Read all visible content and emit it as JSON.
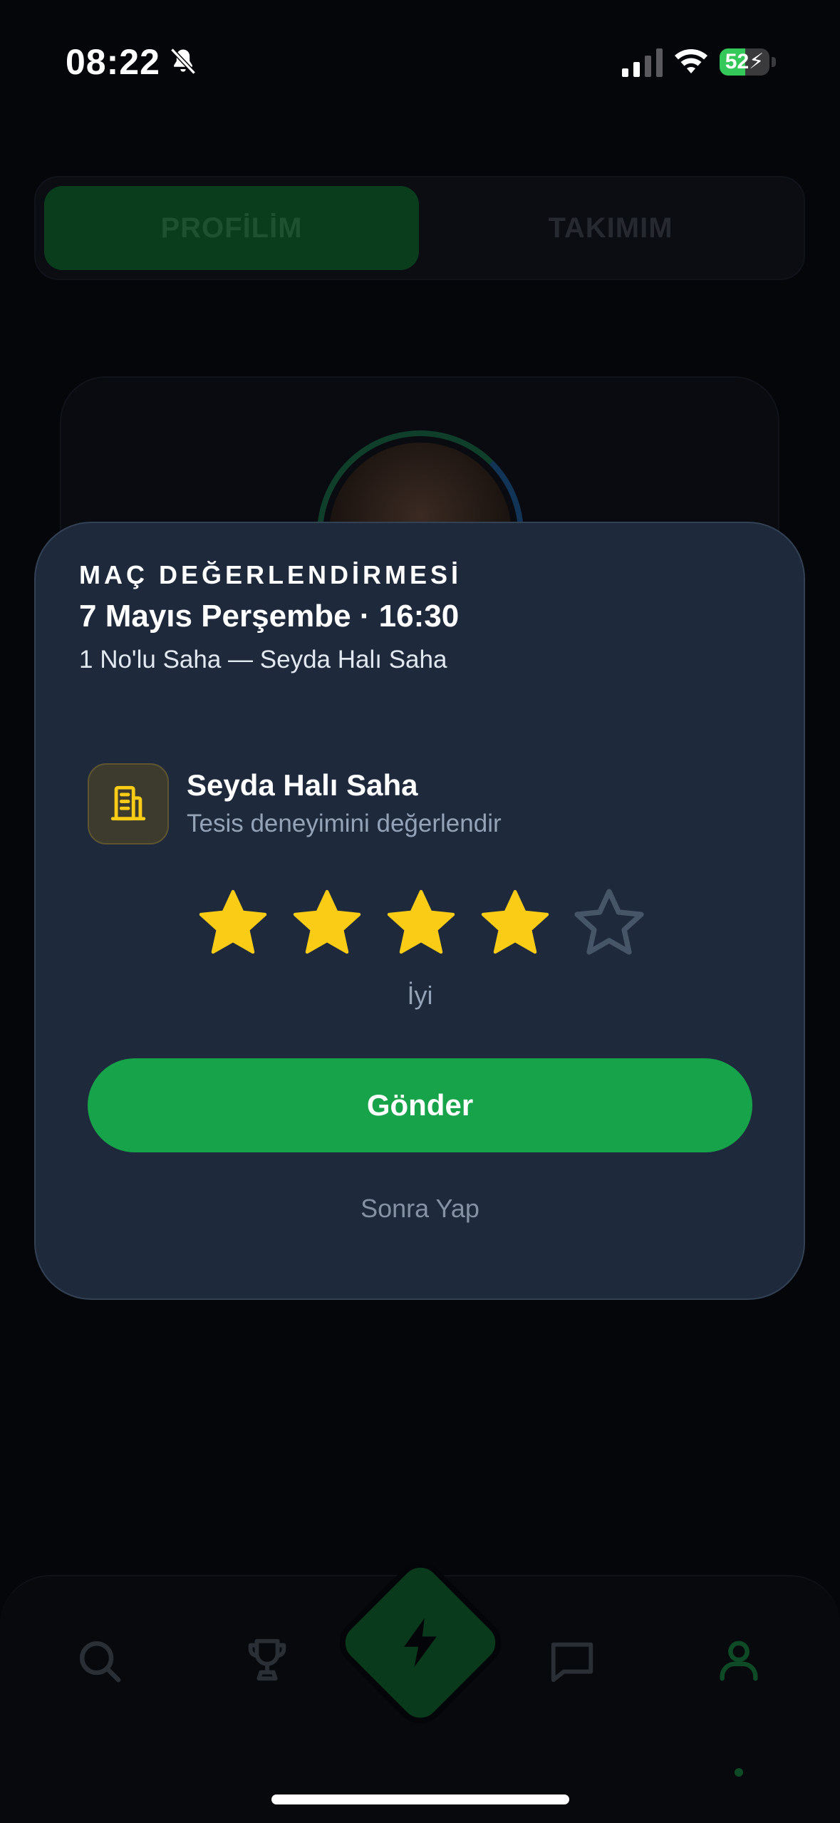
{
  "status_bar": {
    "time": "08:22",
    "battery_level": "52",
    "battery_fraction": 0.52,
    "icons": [
      "bell-slash-icon",
      "cellular-signal-icon",
      "wifi-icon",
      "charging-bolt-icon"
    ]
  },
  "tabs": [
    {
      "label": "PROFİLİM",
      "active": true
    },
    {
      "label": "TAKIMIM",
      "active": false
    }
  ],
  "modal": {
    "eyebrow": "MAÇ DEĞERLENDİRMESİ",
    "title": "7 Mayıs Perşembe · 16:30",
    "subtitle": "1 No'lu Saha — Seyda Halı Saha",
    "facility": {
      "icon": "building-icon",
      "name": "Seyda Halı Saha",
      "hint": "Tesis deneyimini değerlendir"
    },
    "rating": {
      "value": 4,
      "max": 5,
      "label": "İyi"
    },
    "submit_label": "Gönder",
    "later_label": "Sonra Yap"
  },
  "tabbar": {
    "items": [
      "search-icon",
      "trophy-icon",
      "bolt-icon",
      "chat-icon",
      "profile-icon"
    ],
    "active": "profile-icon"
  },
  "colors": {
    "accent": "#16a34a",
    "star_filled": "#facc15",
    "star_empty": "#475569",
    "modal_bg": "#1e293b",
    "page_bg": "#04060a"
  }
}
